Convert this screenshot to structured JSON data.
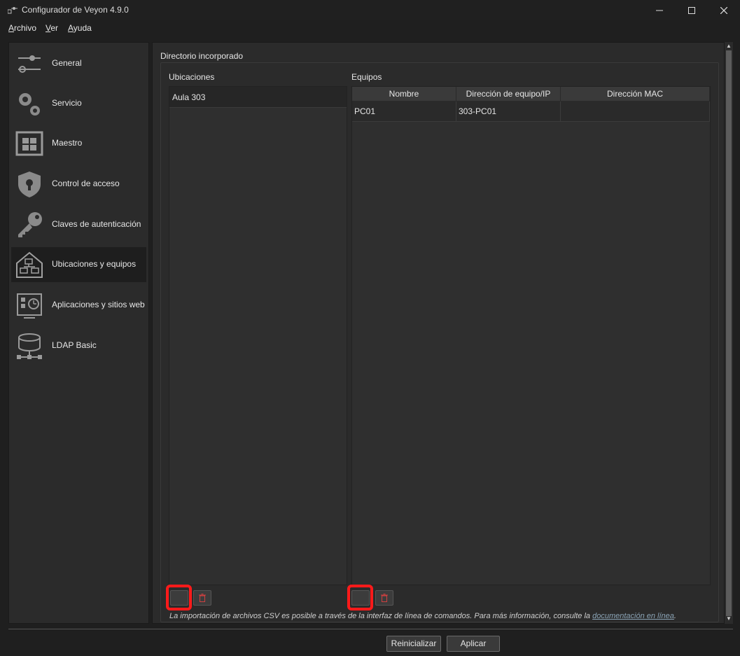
{
  "window": {
    "title": "Configurador de Veyon 4.9.0",
    "controls": [
      "minimize-icon",
      "maximize-icon",
      "close-icon"
    ]
  },
  "menu": [
    {
      "label": "Archivo",
      "accel": "A",
      "rest": "rchivo"
    },
    {
      "label": "Ver",
      "accel": "V",
      "rest": "er"
    },
    {
      "label": "Ayuda",
      "accel": "A",
      "rest": "yuda"
    }
  ],
  "sidebar": {
    "items": [
      {
        "label": "General",
        "icon": "sliders-icon"
      },
      {
        "label": "Servicio",
        "icon": "gears-icon"
      },
      {
        "label": "Maestro",
        "icon": "grid-window-icon"
      },
      {
        "label": "Control de acceso",
        "icon": "shield-lock-icon"
      },
      {
        "label": "Claves de autenticación",
        "icon": "key-icon"
      },
      {
        "label": "Ubicaciones y equipos",
        "icon": "house-computers-icon",
        "active": true
      },
      {
        "label": "Aplicaciones y sitios web",
        "icon": "apps-clock-icon"
      },
      {
        "label": "LDAP Basic",
        "icon": "database-network-icon"
      }
    ]
  },
  "main": {
    "group_title": "Directorio incorporado",
    "locations": {
      "label": "Ubicaciones",
      "items": [
        "Aula 303"
      ]
    },
    "computers": {
      "label": "Equipos",
      "columns": [
        "Nombre",
        "Dirección de equipo/IP",
        "Dirección MAC"
      ],
      "rows": [
        [
          "PC01",
          "303-PC01",
          ""
        ]
      ]
    },
    "footer_note": "La importación de archivos CSV es posible a través de la interfaz de línea de comandos. Para más información, consulte la ",
    "footer_link": "documentación en línea",
    "footer_end": "."
  },
  "buttons": {
    "reset": "Reinicializar",
    "apply": "Aplicar"
  },
  "colors": {
    "highlight": "#ff1a1a",
    "background": "#1f1f1f",
    "panel": "#2b2b2b",
    "link": "#8aa3b5"
  }
}
